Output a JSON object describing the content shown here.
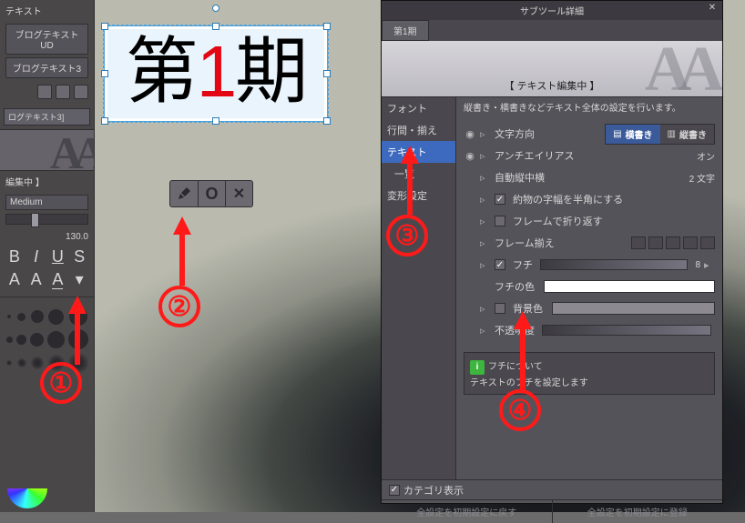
{
  "left_sidebar": {
    "tool_label": "テキスト",
    "preset1": "ブログテキストUD",
    "preset2": "ブログテキスト3",
    "tab_label": "ログテキスト3]",
    "editing_status": "編集中 】",
    "weight": "Medium",
    "font_size": "130.0"
  },
  "canvas": {
    "text_before": "第",
    "text_red": "1",
    "text_after": "期"
  },
  "confirm_bar": {
    "edit": "✎",
    "ok": "●",
    "cancel": "✕"
  },
  "panel": {
    "window_title": "サブツール詳細",
    "tab": "第1期",
    "banner": "【 テキスト編集中 】",
    "categories": {
      "font": "フォント",
      "line": "行間・揃え",
      "text": "テキスト",
      "list": "一覧",
      "transform": "変形設定"
    },
    "description": "縦書き・横書きなどテキスト全体の設定を行います。",
    "rows": {
      "direction": {
        "label": "文字方向",
        "opt1": "横書き",
        "opt2": "縦書き"
      },
      "antialias": {
        "label": "アンチエイリアス",
        "value": "オン"
      },
      "auto_vh": {
        "label": "自動縦中横",
        "value": "2 文字"
      },
      "halfwidth": {
        "label": "約物の字幅を半角にする"
      },
      "frame_wrap": {
        "label": "フレームで折り返す"
      },
      "frame_align": {
        "label": "フレーム揃え"
      },
      "edge": {
        "label": "フチ",
        "value": "8"
      },
      "edge_color": {
        "label": "フチの色"
      },
      "bg_color": {
        "label": "背景色"
      },
      "opacity": {
        "label": "不透明度"
      }
    },
    "help": {
      "title": "フチについて",
      "body": "テキストのフチを設定します"
    },
    "footer": {
      "categories": "カテゴリ表示",
      "reset": "全設定を初期設定に戻す",
      "register": "全設定を初期設定に登録"
    }
  },
  "annotations": {
    "n1": "①",
    "n2": "②",
    "n3": "③",
    "n4": "④"
  }
}
